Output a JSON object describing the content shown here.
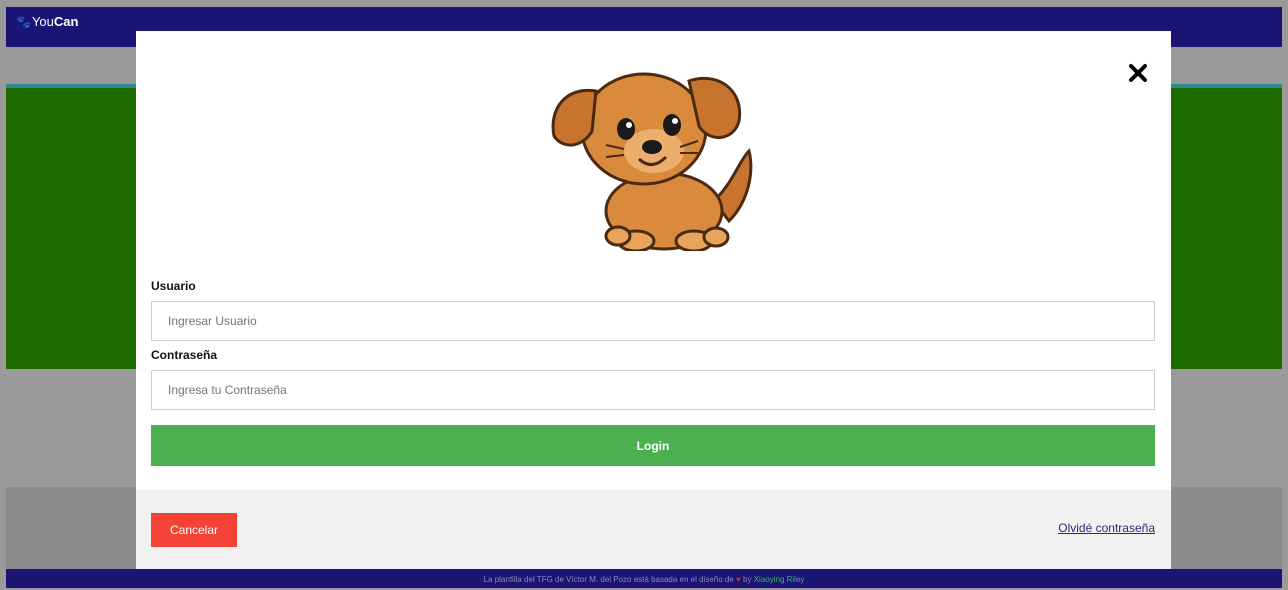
{
  "navbar": {
    "brand_light": "You",
    "brand_bold": "Can",
    "brand_icon": "paw-icon"
  },
  "modal": {
    "image_icon": "puppy-avatar",
    "close_icon": "close-icon",
    "username": {
      "label": "Usuario",
      "placeholder": "Ingresar Usuario",
      "value": ""
    },
    "password": {
      "label": "Contraseña",
      "placeholder": "Ingresa tu Contraseña",
      "value": ""
    },
    "login_label": "Login",
    "cancel_label": "Cancelar",
    "forgot_label": "Olvidé contraseña"
  },
  "footer": {
    "text_before": "La plantilla del TFG de Víctor M. del Pozo está basada en el diseño de",
    "text_by": "by",
    "author": "Xiaoying Riley"
  },
  "colors": {
    "navbar": "#1a1575",
    "green_panel": "#1e6b00",
    "login": "#4caf50",
    "cancel": "#f44336"
  }
}
